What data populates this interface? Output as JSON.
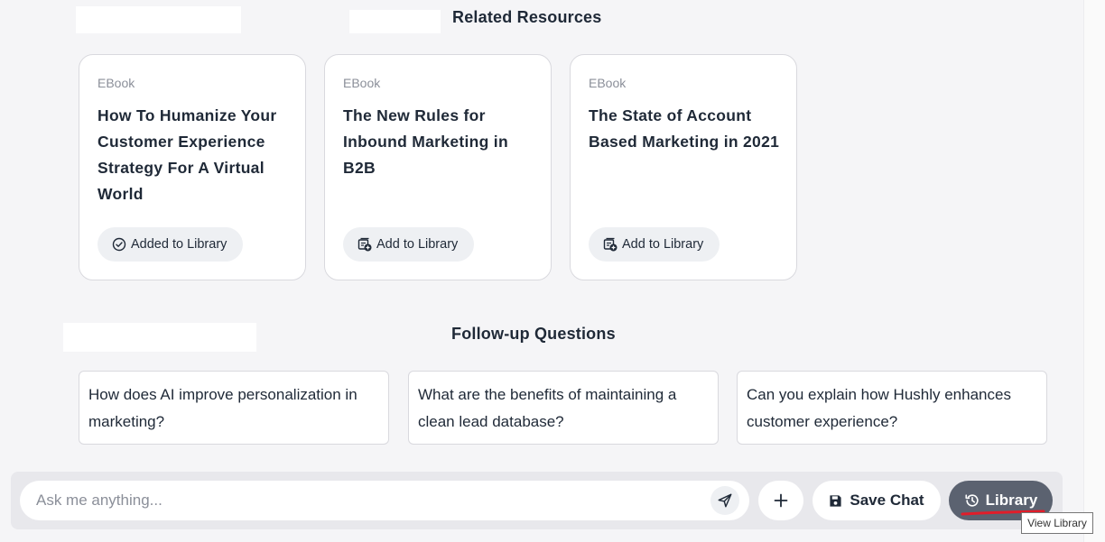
{
  "related": {
    "title": "Related Resources",
    "cards": [
      {
        "kind": "EBook",
        "title": "How To Humanize Your Customer Experience Strategy For A Virtual World",
        "button": "Added to Library",
        "state": "added"
      },
      {
        "kind": "EBook",
        "title": "The New Rules for Inbound Marketing in B2B",
        "button": "Add to Library",
        "state": "add"
      },
      {
        "kind": "EBook",
        "title": "The State of Account Based Marketing in 2021",
        "button": "Add to Library",
        "state": "add"
      }
    ]
  },
  "followup": {
    "title": "Follow-up Questions",
    "questions": [
      "How does AI improve personalization in marketing?",
      "What are the benefits of maintaining a clean lead database?",
      "Can you explain how Hushly enhances customer experience?"
    ]
  },
  "chatbar": {
    "placeholder": "Ask me anything...",
    "send_icon": "send-icon",
    "plus_icon": "plus-icon",
    "save_label": "Save Chat",
    "save_icon": "floppy-disk-icon",
    "library_label": "Library",
    "library_icon": "history-icon",
    "tooltip": "View Library"
  },
  "colors": {
    "library_button_bg": "#5b6270",
    "annotation_red": "#e11d2a"
  }
}
